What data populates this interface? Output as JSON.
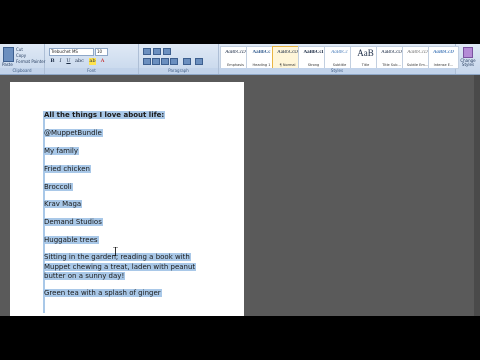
{
  "ribbon": {
    "clipboard": {
      "paste": "Paste",
      "cut": "Cut",
      "copy": "Copy",
      "format_painter": "Format Painter",
      "label": "Clipboard"
    },
    "font": {
      "name": "Trebuchet MS",
      "size": "10",
      "label": "Font"
    },
    "paragraph": {
      "label": "Paragraph"
    },
    "styles": {
      "label": "Styles",
      "items": [
        {
          "sample": "AaBbCcD",
          "name": "Emphasis"
        },
        {
          "sample": "AaBbCc",
          "name": "Heading 1"
        },
        {
          "sample": "AaBbCcD",
          "name": "¶ Normal"
        },
        {
          "sample": "AaBbCcI",
          "name": "Strong"
        },
        {
          "sample": "AaBbCc",
          "name": "Subtitle"
        },
        {
          "sample": "AaB",
          "name": "Title"
        },
        {
          "sample": "AaBbCcD",
          "name": "Title Sub..."
        },
        {
          "sample": "AaBbCcD",
          "name": "Subtle Em..."
        },
        {
          "sample": "AaBbCcD",
          "name": "Intense E..."
        }
      ],
      "change_styles": "Change Styles"
    }
  },
  "document": {
    "lines": [
      {
        "text": "All the things I love about life:",
        "bold": true
      },
      {
        "text": "@MuppetBundle"
      },
      {
        "text": "My family"
      },
      {
        "text": "Fried chicken"
      },
      {
        "text": "Broccoli"
      },
      {
        "text": "Krav Maga"
      },
      {
        "text": "Demand Studios"
      },
      {
        "text": "Huggable trees"
      },
      {
        "text": "Sitting in the garden, reading a book with"
      },
      {
        "text": "Muppet chewing a treat, laden with peanut"
      },
      {
        "text": "butter on a sunny day!"
      },
      {
        "text": "Green tea with a splash of ginger"
      }
    ]
  },
  "colors": {
    "selection": "#a9c8e8",
    "ribbon": "#dfe9f5"
  }
}
